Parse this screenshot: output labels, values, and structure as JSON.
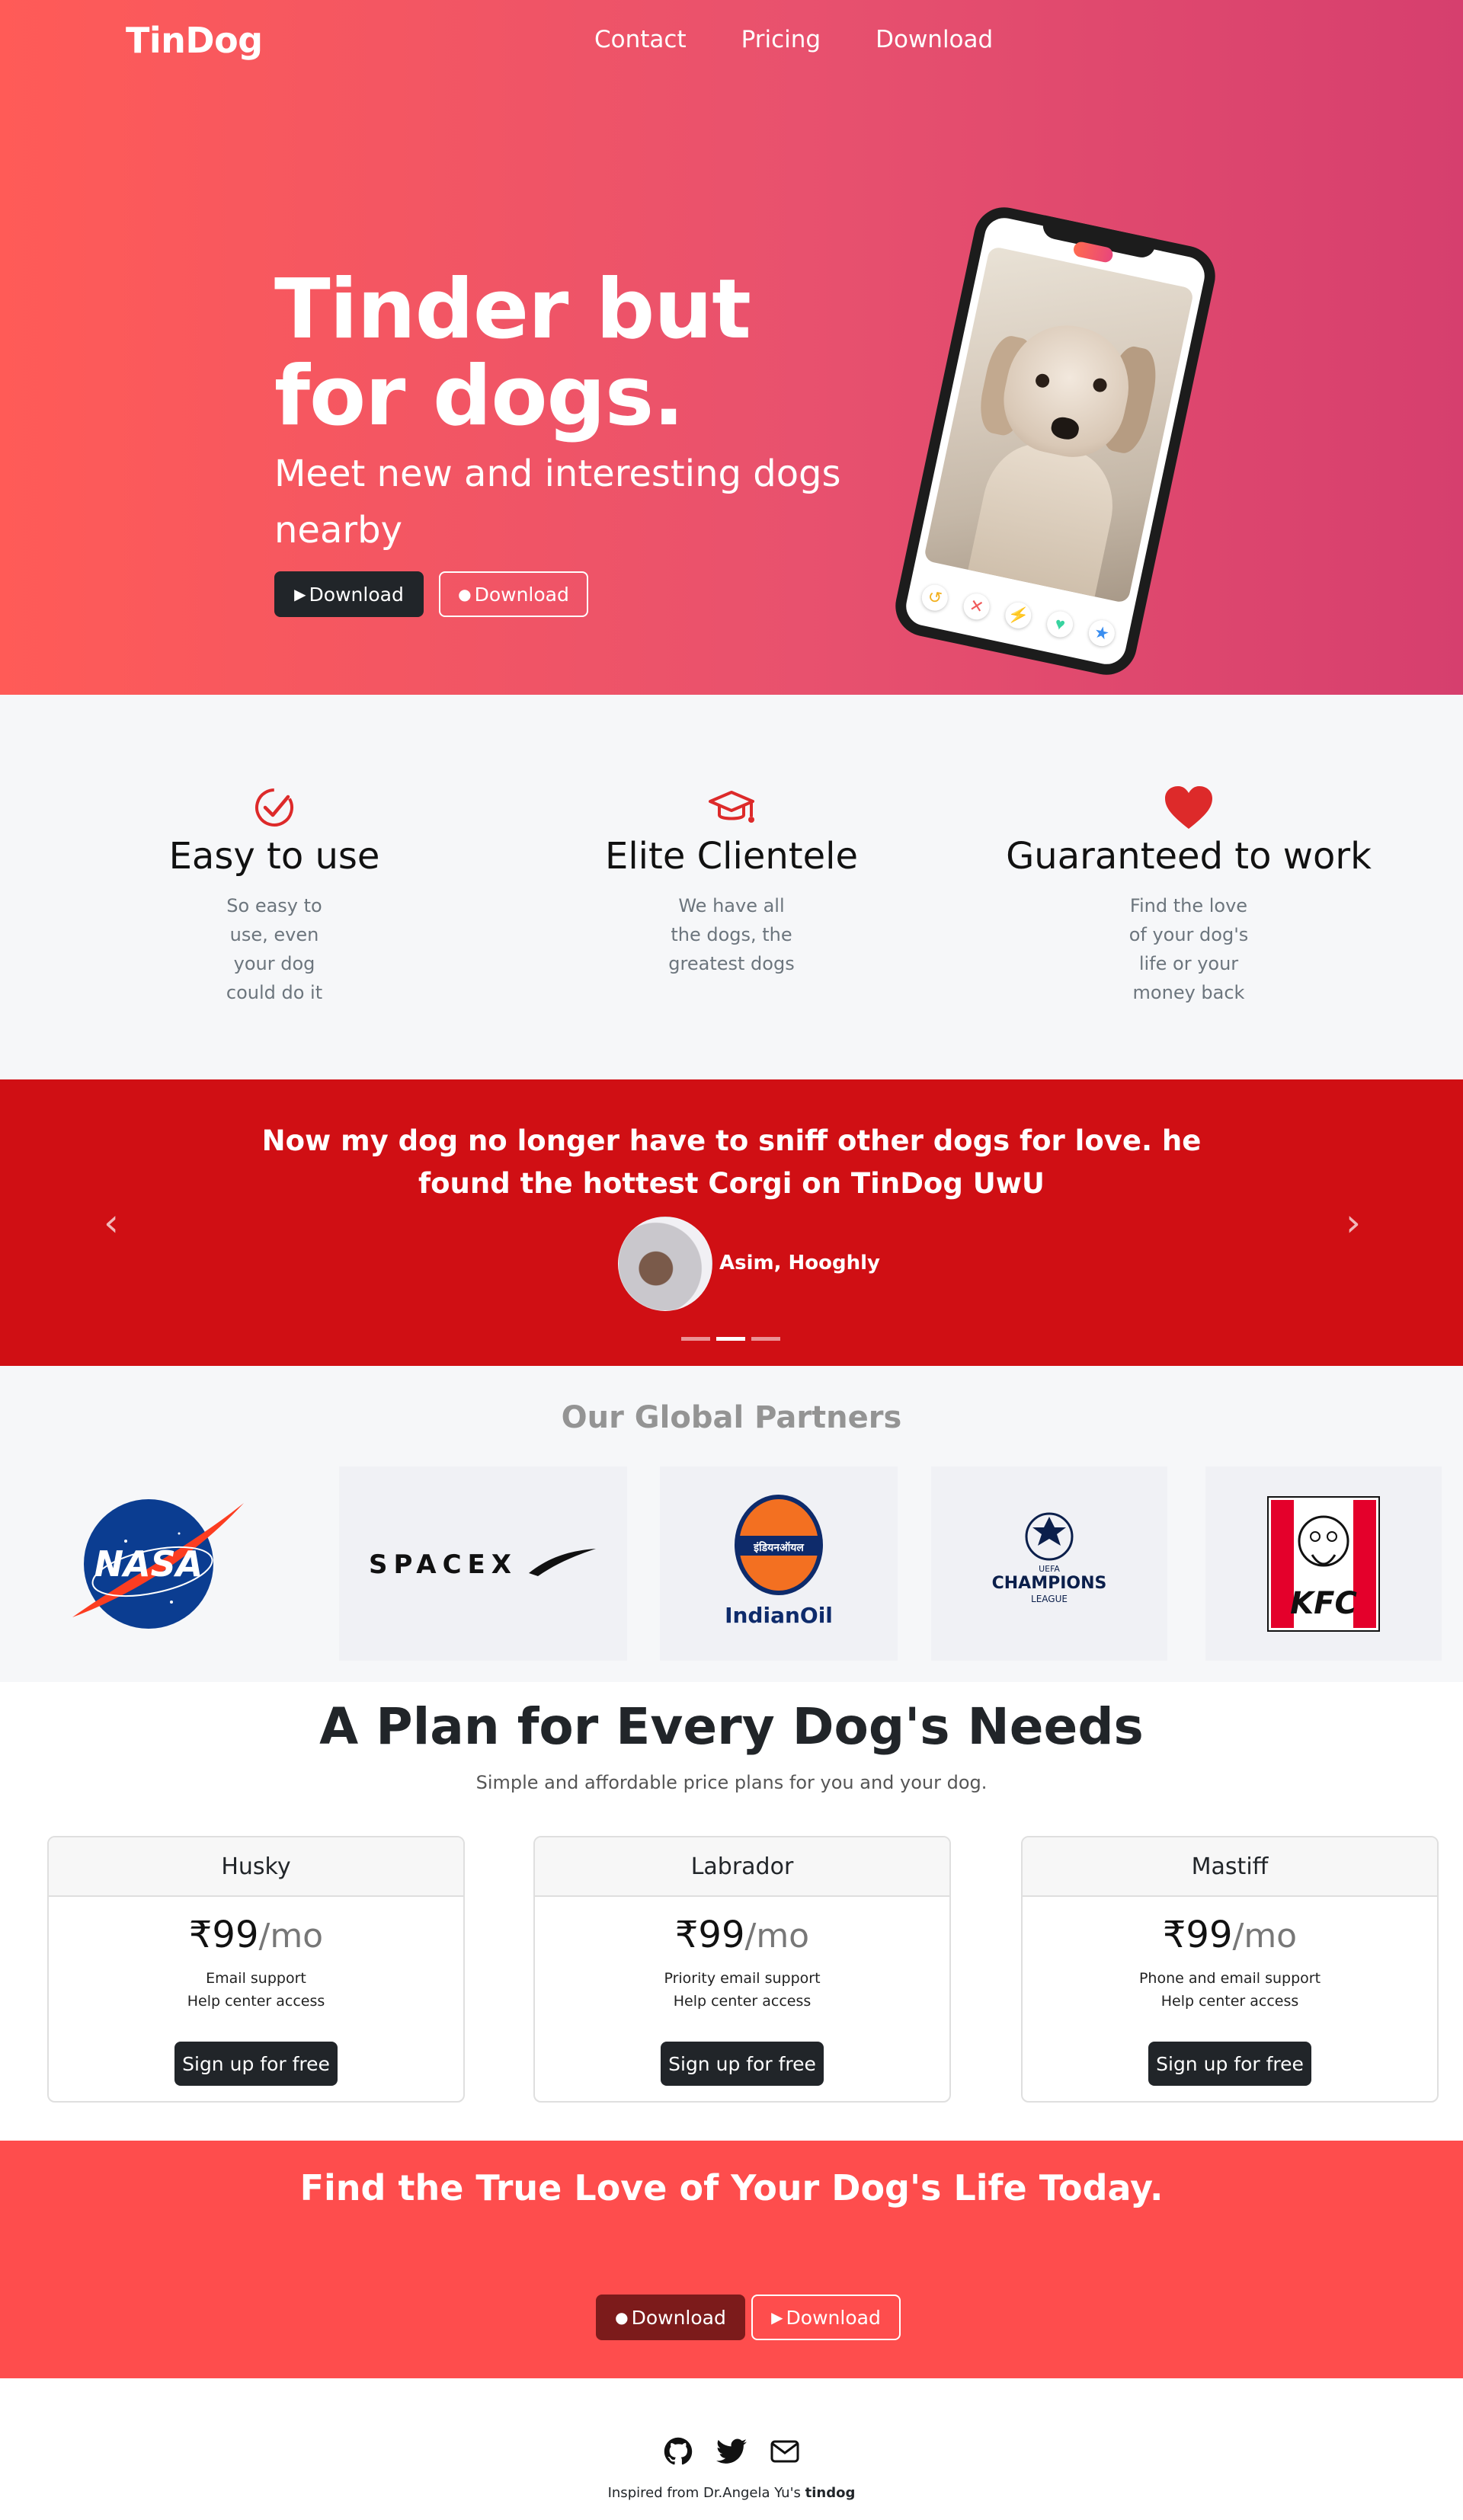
{
  "nav": {
    "brand": "TinDog",
    "links": [
      "Contact",
      "Pricing",
      "Download"
    ]
  },
  "hero": {
    "title": "Tinder but for dogs.",
    "subtitle": "Meet new and interesting dogs nearby",
    "btn_primary": "Download",
    "btn_secondary": "Download"
  },
  "features": [
    {
      "icon": "check-circle-icon",
      "title": "Easy to use",
      "text": "So easy to use, even your dog could do it"
    },
    {
      "icon": "graduation-cap-icon",
      "title": "Elite Clientele",
      "text": "We have all the dogs, the greatest dogs"
    },
    {
      "icon": "heart-icon",
      "title": "Guaranteed to work",
      "text": "Find the love of your dog's life or your money back"
    }
  ],
  "testimonial": {
    "quote": "Now my dog no longer have to sniff other dogs for love. he found the hottest Corgi on TinDog UwU",
    "author": "Asim, Hooghly"
  },
  "partners": {
    "title": "Our Global Partners",
    "logos": [
      {
        "name": "nasa-logo",
        "text": "NASA"
      },
      {
        "name": "spacex-logo",
        "text": "SPACEX"
      },
      {
        "name": "indianoil-logo",
        "text": "IndianOil",
        "hindi": "इंडियनऑयल"
      },
      {
        "name": "champions-league-logo",
        "text": "CHAMPIONS",
        "sub": "LEAGUE",
        "top": "UEFA"
      },
      {
        "name": "kfc-logo",
        "text": "KFC"
      }
    ]
  },
  "pricing": {
    "title": "A Plan for Every Dog's Needs",
    "subtitle": "Simple and affordable price plans for you and your dog.",
    "plans": [
      {
        "name": "Husky",
        "price": "₹99",
        "per": "/mo",
        "features": [
          "Email support",
          "Help center access"
        ],
        "cta": "Sign up for free"
      },
      {
        "name": "Labrador",
        "price": "₹99",
        "per": "/mo",
        "features": [
          "Priority email support",
          "Help center access"
        ],
        "cta": "Sign up for free"
      },
      {
        "name": "Mastiff",
        "price": "₹99",
        "per": "/mo",
        "features": [
          "Phone and email support",
          "Help center access"
        ],
        "cta": "Sign up for free"
      }
    ]
  },
  "cta": {
    "title": "Find the True Love of Your Dog's Life Today.",
    "btn_apple": "Download",
    "btn_play": "Download"
  },
  "footer": {
    "credit_prefix": "Inspired from Dr.Angela Yu's ",
    "credit_bold": "tindog"
  },
  "colors": {
    "hero_gradient_start": "#ff5b57",
    "hero_gradient_end": "#d63f6e",
    "testimonial_bg": "#d00f14",
    "cta_bg": "#fe4d4d",
    "dark_button": "#212529",
    "icon_red": "#dd2a2a"
  }
}
